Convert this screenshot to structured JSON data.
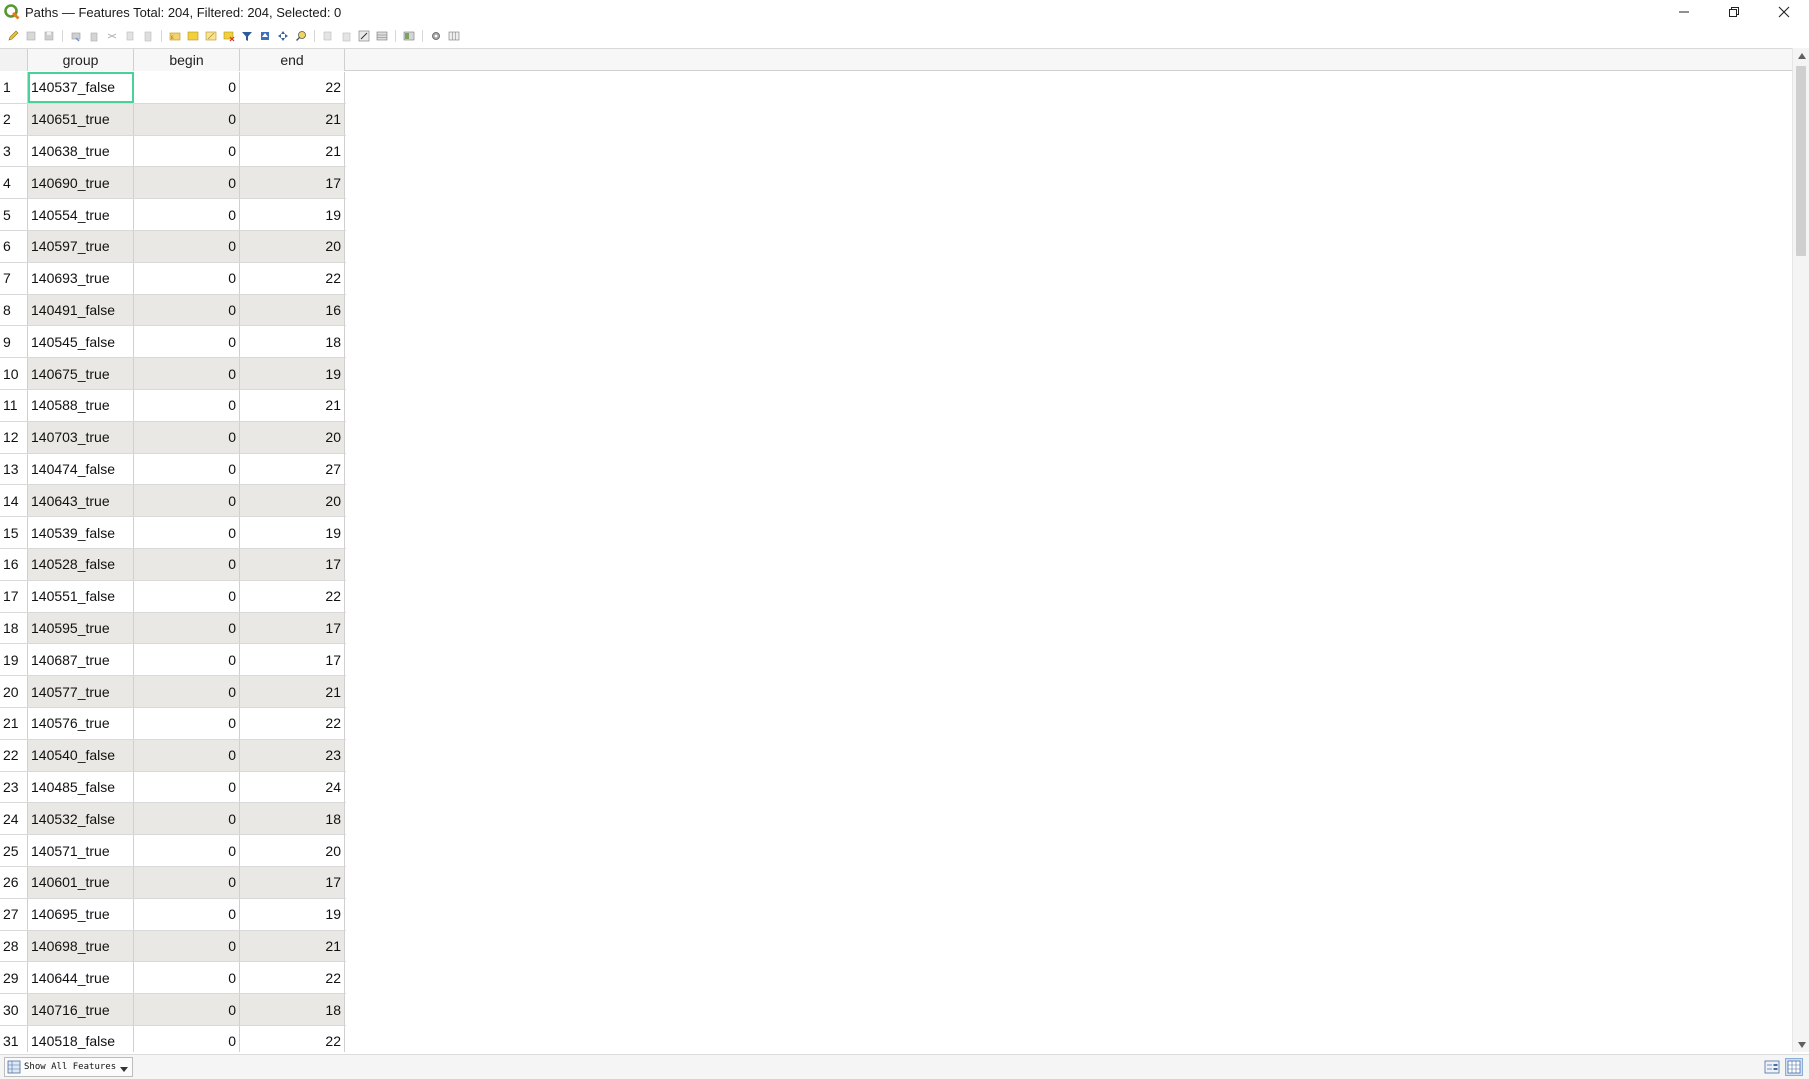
{
  "window": {
    "title": "Paths — Features Total: 204, Filtered: 204, Selected: 0",
    "controls": [
      "minimize-icon",
      "restore-icon",
      "close-icon"
    ]
  },
  "toolbar": {
    "icons": [
      "pencil-icon",
      "multi-edit-icon",
      "save-icon",
      "reload-icon",
      "add-feature-icon",
      "delete-icon",
      "cut-icon",
      "copy-icon",
      "paste-icon",
      "select-expression-icon",
      "select-all-icon",
      "invert-selection-icon",
      "deselect-icon",
      "filter-icon",
      "move-top-icon",
      "pan-icon",
      "zoom-selection-icon",
      "copy-rows-icon",
      "paste-rows-icon",
      "field-calculator-icon",
      "conditional-format-icon",
      "dock-icon",
      "actions-icon",
      "organize-columns-icon"
    ]
  },
  "table": {
    "columns": [
      "group",
      "begin",
      "end"
    ],
    "rows": [
      {
        "n": "1",
        "group": "140537_false",
        "begin": "0",
        "end": "22"
      },
      {
        "n": "2",
        "group": "140651_true",
        "begin": "0",
        "end": "21"
      },
      {
        "n": "3",
        "group": "140638_true",
        "begin": "0",
        "end": "21"
      },
      {
        "n": "4",
        "group": "140690_true",
        "begin": "0",
        "end": "17"
      },
      {
        "n": "5",
        "group": "140554_true",
        "begin": "0",
        "end": "19"
      },
      {
        "n": "6",
        "group": "140597_true",
        "begin": "0",
        "end": "20"
      },
      {
        "n": "7",
        "group": "140693_true",
        "begin": "0",
        "end": "22"
      },
      {
        "n": "8",
        "group": "140491_false",
        "begin": "0",
        "end": "16"
      },
      {
        "n": "9",
        "group": "140545_false",
        "begin": "0",
        "end": "18"
      },
      {
        "n": "10",
        "group": "140675_true",
        "begin": "0",
        "end": "19"
      },
      {
        "n": "11",
        "group": "140588_true",
        "begin": "0",
        "end": "21"
      },
      {
        "n": "12",
        "group": "140703_true",
        "begin": "0",
        "end": "20"
      },
      {
        "n": "13",
        "group": "140474_false",
        "begin": "0",
        "end": "27"
      },
      {
        "n": "14",
        "group": "140643_true",
        "begin": "0",
        "end": "20"
      },
      {
        "n": "15",
        "group": "140539_false",
        "begin": "0",
        "end": "19"
      },
      {
        "n": "16",
        "group": "140528_false",
        "begin": "0",
        "end": "17"
      },
      {
        "n": "17",
        "group": "140551_false",
        "begin": "0",
        "end": "22"
      },
      {
        "n": "18",
        "group": "140595_true",
        "begin": "0",
        "end": "17"
      },
      {
        "n": "19",
        "group": "140687_true",
        "begin": "0",
        "end": "17"
      },
      {
        "n": "20",
        "group": "140577_true",
        "begin": "0",
        "end": "21"
      },
      {
        "n": "21",
        "group": "140576_true",
        "begin": "0",
        "end": "22"
      },
      {
        "n": "22",
        "group": "140540_false",
        "begin": "0",
        "end": "23"
      },
      {
        "n": "23",
        "group": "140485_false",
        "begin": "0",
        "end": "24"
      },
      {
        "n": "24",
        "group": "140532_false",
        "begin": "0",
        "end": "18"
      },
      {
        "n": "25",
        "group": "140571_true",
        "begin": "0",
        "end": "20"
      },
      {
        "n": "26",
        "group": "140601_true",
        "begin": "0",
        "end": "17"
      },
      {
        "n": "27",
        "group": "140695_true",
        "begin": "0",
        "end": "19"
      },
      {
        "n": "28",
        "group": "140698_true",
        "begin": "0",
        "end": "21"
      },
      {
        "n": "29",
        "group": "140644_true",
        "begin": "0",
        "end": "22"
      },
      {
        "n": "30",
        "group": "140716_true",
        "begin": "0",
        "end": "18"
      },
      {
        "n": "31",
        "group": "140518_false",
        "begin": "0",
        "end": "22"
      }
    ]
  },
  "statusbar": {
    "filter_label": "Show All Features"
  },
  "colors": {
    "accent": "#46d39a",
    "alt_row": "#e9e8e4"
  }
}
